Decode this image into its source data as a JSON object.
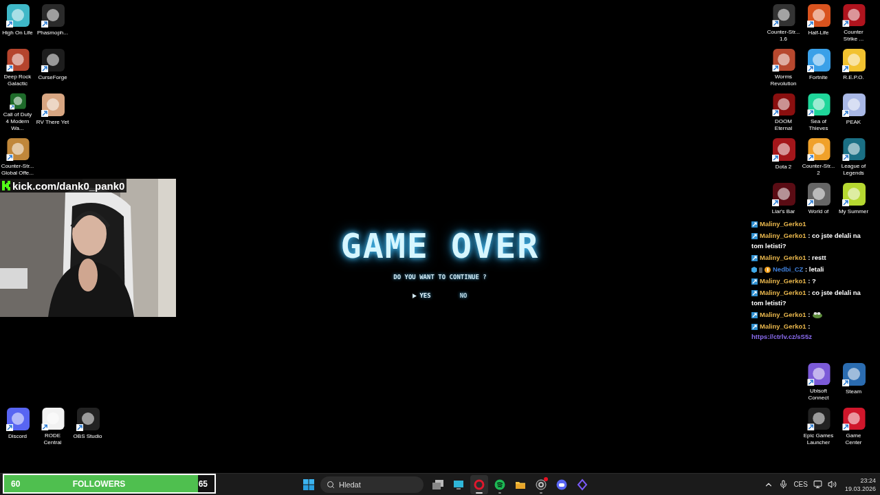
{
  "desktop": {
    "left_icons": [
      {
        "label": "High On Life"
      },
      {
        "label": "Phasmoph..."
      },
      {
        "label": "Deep Rock Galactic"
      },
      {
        "label": "CurseForge"
      },
      {
        "label": "Call of Duty 4 Modern Wa..."
      },
      {
        "label": "RV There Yet"
      },
      {
        "label": "Counter-Str... Global Offe..."
      }
    ],
    "right_icons": [
      {
        "label": "Counter-Str... 1.6"
      },
      {
        "label": "Half-Life"
      },
      {
        "label": "Counter Strike ..."
      },
      {
        "label": "Worms Revolution"
      },
      {
        "label": "Fortnite"
      },
      {
        "label": "R.E.P.O."
      },
      {
        "label": "DOOM Eternal"
      },
      {
        "label": "Sea of Thieves"
      },
      {
        "label": "PEAK"
      },
      {
        "label": "Dota 2"
      },
      {
        "label": "Counter-Str... 2"
      },
      {
        "label": "League of Legends"
      },
      {
        "label": "Liar's Bar"
      },
      {
        "label": "World of"
      },
      {
        "label": "My Summer"
      }
    ],
    "bottom_left_icons": [
      {
        "label": "Discord"
      },
      {
        "label": "RODE Central"
      },
      {
        "label": "OBS Studio"
      }
    ],
    "bottom_right_icons": [
      {
        "label": "Ubisoft Connect"
      },
      {
        "label": "Steam"
      },
      {
        "label": "Epic Games Launcher"
      },
      {
        "label": "Game Center"
      }
    ]
  },
  "stream_overlay": {
    "channel_url": "kick.com/dank0_pank0",
    "chat": [
      {
        "kind": "subscriber",
        "user": "Maliny_Gerko1",
        "color": "#e8b64c"
      },
      {
        "kind": "subscriber",
        "user": "Maliny_Gerko1",
        "color": "#e8b64c",
        "separator": ":",
        "text": "co jste delali na",
        "continuation": "tom letisti?"
      },
      {
        "kind": "subscriber",
        "user": "Maliny_Gerko1",
        "color": "#e8b64c",
        "separator": ":",
        "text": "restt"
      },
      {
        "kind": "gifter",
        "user": "Nedbi_CZ",
        "color": "#3f7fd8",
        "separator": ":",
        "text": "letali"
      },
      {
        "kind": "subscriber",
        "user": "Maliny_Gerko1",
        "color": "#e8b64c",
        "separator": ":",
        "text": "?"
      },
      {
        "kind": "subscriber",
        "user": "Maliny_Gerko1",
        "color": "#e8b64c",
        "separator": ":",
        "text": "co jste delali na",
        "continuation": "tom letisti?"
      },
      {
        "kind": "subscriber",
        "user": "Maliny_Gerko1",
        "color": "#e8b64c",
        "separator": ":",
        "emote": true
      },
      {
        "kind": "subscriber",
        "user": "Maliny_Gerko1",
        "color": "#e8b64c",
        "separator": ":",
        "link": "https://ctrlv.cz/sS5z"
      }
    ],
    "follower_goal": {
      "current": "60",
      "label": "FOLLOWERS",
      "goal": "65",
      "level": 0.92
    }
  },
  "game": {
    "title": "GAME OVER",
    "prompt": "DO YOU WANT TO CONTINUE ?",
    "options": [
      {
        "label": "YES",
        "selected": true
      },
      {
        "label": "NO",
        "selected": false
      }
    ]
  },
  "taskbar": {
    "search": {
      "placeholder": "Hledat"
    },
    "apps": [
      {
        "running": false,
        "selected": false,
        "notification": false
      },
      {
        "running": true,
        "selected": true,
        "notification": false
      },
      {
        "running": true,
        "selected": false,
        "notification": false
      },
      {
        "running": false,
        "selected": false,
        "notification": false
      },
      {
        "running": true,
        "selected": false,
        "notification": true
      },
      {
        "running": false,
        "selected": false,
        "notification": false
      },
      {
        "running": false,
        "selected": false,
        "notification": false
      }
    ],
    "tray": {
      "language": "CES",
      "time": "23:24",
      "date": "19.03.2026"
    }
  }
}
